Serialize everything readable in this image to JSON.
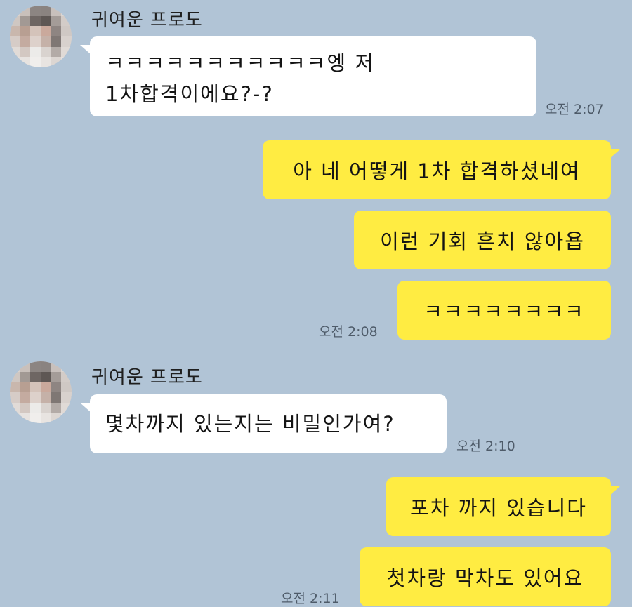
{
  "chat": {
    "groups": [
      {
        "sender": "귀여운 프로도",
        "messages": [
          {
            "line1": "ㅋㅋㅋㅋㅋㅋㅋㅋㅋㅋㅋ엥 저",
            "line2": "1차합격이에요?-?",
            "time": "오전 2:07"
          }
        ]
      },
      {
        "messages": [
          {
            "text": "아 네 어떻게 1차 합격하셨네여"
          },
          {
            "text": "이런 기회 흔치 않아욥"
          },
          {
            "text": "ㅋㅋㅋㅋㅋㅋㅋㅋ",
            "time": "오전 2:08"
          }
        ]
      },
      {
        "sender": "귀여운 프로도",
        "messages": [
          {
            "text": "몇차까지 있는지는 비밀인가여?",
            "time": "오전 2:10"
          }
        ]
      },
      {
        "messages": [
          {
            "text": "포차 까지 있습니다"
          },
          {
            "text": "첫차랑 막차도 있어요",
            "time": "오전 2:11"
          }
        ]
      }
    ]
  },
  "colors": {
    "background": "#b1c4d6",
    "my_bubble": "#ffec42",
    "other_bubble": "#ffffff"
  }
}
